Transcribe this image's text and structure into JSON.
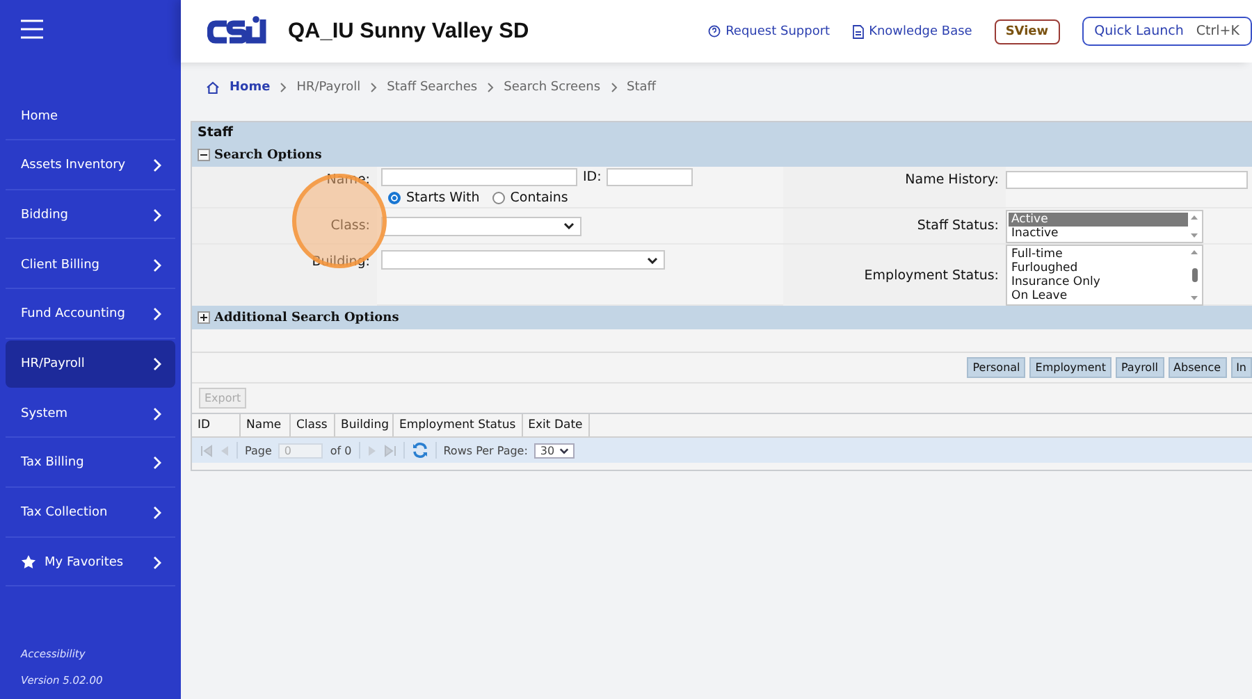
{
  "sidebar": {
    "items": [
      {
        "label": "Home",
        "kind": "plain",
        "selected": false,
        "submenu": false
      },
      {
        "label": "Assets Inventory",
        "kind": "plain",
        "selected": false,
        "submenu": true
      },
      {
        "label": "Bidding",
        "kind": "plain",
        "selected": false,
        "submenu": true
      },
      {
        "label": "Client Billing",
        "kind": "plain",
        "selected": false,
        "submenu": true
      },
      {
        "label": "Fund Accounting",
        "kind": "plain",
        "selected": false,
        "submenu": true
      },
      {
        "label": "HR/Payroll",
        "kind": "plain",
        "selected": true,
        "submenu": true
      },
      {
        "label": "System",
        "kind": "plain",
        "selected": false,
        "submenu": true
      },
      {
        "label": "Tax Billing",
        "kind": "plain",
        "selected": false,
        "submenu": true
      },
      {
        "label": "Tax Collection",
        "kind": "plain",
        "selected": false,
        "submenu": true
      },
      {
        "label": "My Favorites",
        "kind": "star",
        "selected": false,
        "submenu": true
      }
    ],
    "footer": [
      "Accessibility",
      "Version 5.02.00"
    ]
  },
  "header": {
    "title": "QA_IU Sunny Valley SD",
    "links": [
      {
        "label": "Request Support",
        "kind": "help"
      },
      {
        "label": "Knowledge Base",
        "kind": "doc"
      }
    ],
    "sview": "SView",
    "quick_launch": {
      "label": "Quick Launch",
      "shortcut": "Ctrl+K"
    }
  },
  "breadcrumb": [
    "Home",
    "HR/Payroll",
    "Staff Searches",
    "Search Screens",
    "Staff"
  ],
  "panel": {
    "title": "Staff",
    "search_options": {
      "label": "Search Options",
      "expanded": true
    },
    "name": {
      "label": "Name:",
      "id_label": "ID:",
      "match": [
        {
          "label": "Starts With",
          "selected": true
        },
        {
          "label": "Contains",
          "selected": false
        }
      ]
    },
    "class_label": "Class:",
    "building_label": "Building:",
    "name_history_label": "Name History:",
    "staff_status": {
      "label": "Staff Status:",
      "options": [
        {
          "label": "Active",
          "selected": true
        },
        {
          "label": "Inactive",
          "selected": false
        }
      ]
    },
    "employment_status": {
      "label": "Employment Status:",
      "options": [
        {
          "label": "Full-time",
          "selected": false
        },
        {
          "label": "Furloughed",
          "selected": false
        },
        {
          "label": "Insurance Only",
          "selected": false
        },
        {
          "label": "On Leave",
          "selected": false
        }
      ]
    },
    "additional": {
      "label": "Additional Search Options",
      "expanded": false
    },
    "views": [
      "Personal",
      "Employment",
      "Payroll",
      "Absence",
      "In"
    ],
    "export": {
      "label": "Export",
      "disabled": true
    },
    "columns": [
      "ID",
      "Name",
      "Class",
      "Building",
      "Employment Status",
      "Exit Date"
    ],
    "pager": {
      "page_label": "Page",
      "page": "0",
      "of": "of 0",
      "rows_label": "Rows Per Page:",
      "rows": "30"
    }
  },
  "click_highlight": true
}
